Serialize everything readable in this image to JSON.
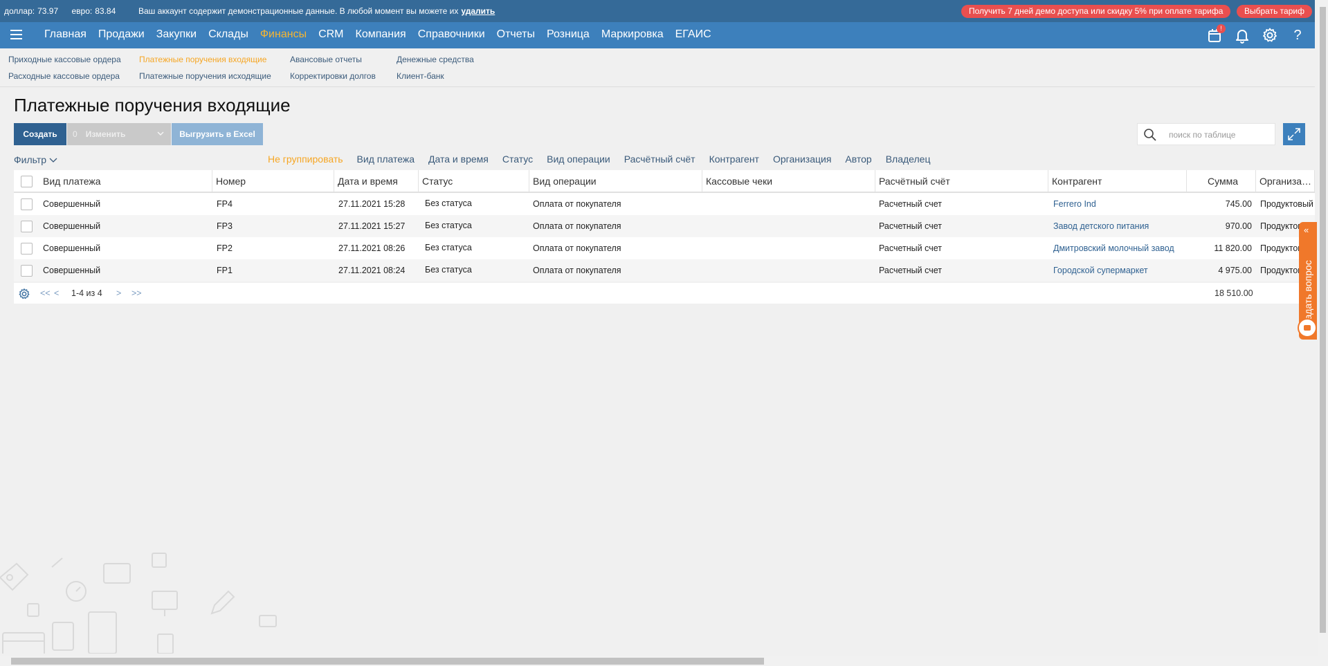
{
  "topbar": {
    "dollar_label": "доллар:",
    "dollar_value": "73.97",
    "euro_label": "евро:",
    "euro_value": "83.84",
    "demo_message": "Ваш аккаунт содержит демонстрационные данные. В любой момент вы можете их",
    "demo_delete_link": "удалить",
    "promo_button": "Получить 7 дней демо доступа или скидку 5% при оплате тарифа",
    "tariff_button": "Выбрать тариф"
  },
  "nav": {
    "items": [
      "Главная",
      "Продажи",
      "Закупки",
      "Склады",
      "Финансы",
      "CRM",
      "Компания",
      "Справочники",
      "Отчеты",
      "Розница",
      "Маркировка",
      "ЕГАИС"
    ],
    "active": "Финансы",
    "notification_badge": "!",
    "help": "?"
  },
  "subnav": {
    "col1": [
      "Приходные кассовые ордера",
      "Расходные кассовые ордера"
    ],
    "col2": [
      "Платежные поручения входящие",
      "Платежные поручения исходящие"
    ],
    "col3": [
      "Авансовые отчеты",
      "Корректировки долгов"
    ],
    "col4": [
      "Денежные средства",
      "Клиент-банк"
    ],
    "active": "Платежные поручения входящие"
  },
  "page": {
    "title": "Платежные поручения входящие"
  },
  "toolbar": {
    "create": "Создать",
    "change_count": "0",
    "change": "Изменить",
    "excel": "Выгрузить в Excel",
    "search_placeholder": "поиск по таблице"
  },
  "filter_label": "Фильтр",
  "groupby": [
    "Не группировать",
    "Вид платежа",
    "Дата и время",
    "Статус",
    "Вид операции",
    "Расчётный счёт",
    "Контрагент",
    "Организация",
    "Автор",
    "Владелец"
  ],
  "groupby_active": "Не группировать",
  "table": {
    "columns": [
      "Вид платежа",
      "Номер",
      "Дата и время",
      "Статус",
      "Вид операции",
      "Кассовые чеки",
      "Расчётный счёт",
      "Контрагент",
      "Сумма",
      "Организация"
    ],
    "rows": [
      {
        "type": "Совершенный",
        "number": "FP4",
        "datetime": "27.11.2021 15:28",
        "status": "Без статуса",
        "operation": "Оплата от покупателя",
        "receipts": "",
        "account": "Расчетный счет",
        "counterparty": "Ferrero Ind",
        "amount": "745.00",
        "org": "Продуктовый"
      },
      {
        "type": "Совершенный",
        "number": "FP3",
        "datetime": "27.11.2021 15:27",
        "status": "Без статуса",
        "operation": "Оплата от покупателя",
        "receipts": "",
        "account": "Расчетный счет",
        "counterparty": "Завод детского питания",
        "amount": "970.00",
        "org": "Продуктовый"
      },
      {
        "type": "Совершенный",
        "number": "FP2",
        "datetime": "27.11.2021 08:26",
        "status": "Без статуса",
        "operation": "Оплата от покупателя",
        "receipts": "",
        "account": "Расчетный счет",
        "counterparty": "Дмитровский молочный завод",
        "amount": "11 820.00",
        "org": "Продуктовый"
      },
      {
        "type": "Совершенный",
        "number": "FP1",
        "datetime": "27.11.2021 08:24",
        "status": "Без статуса",
        "operation": "Оплата от покупателя",
        "receipts": "",
        "account": "Расчетный счет",
        "counterparty": "Городской супермаркет",
        "amount": "4 975.00",
        "org": "Продуктовый"
      }
    ]
  },
  "pagination": {
    "first": "<<",
    "prev": "<",
    "range": "1-4 из 4",
    "next": ">",
    "last": ">>",
    "total": "18 510.00"
  },
  "ask_question": "Задать вопрос",
  "colors": {
    "topbar": "#356a98",
    "navbar": "#3d80bc",
    "accent": "#f6a623",
    "promo": "#e94f4f",
    "create_button": "#2f6191",
    "ask_question": "#f0782a"
  }
}
